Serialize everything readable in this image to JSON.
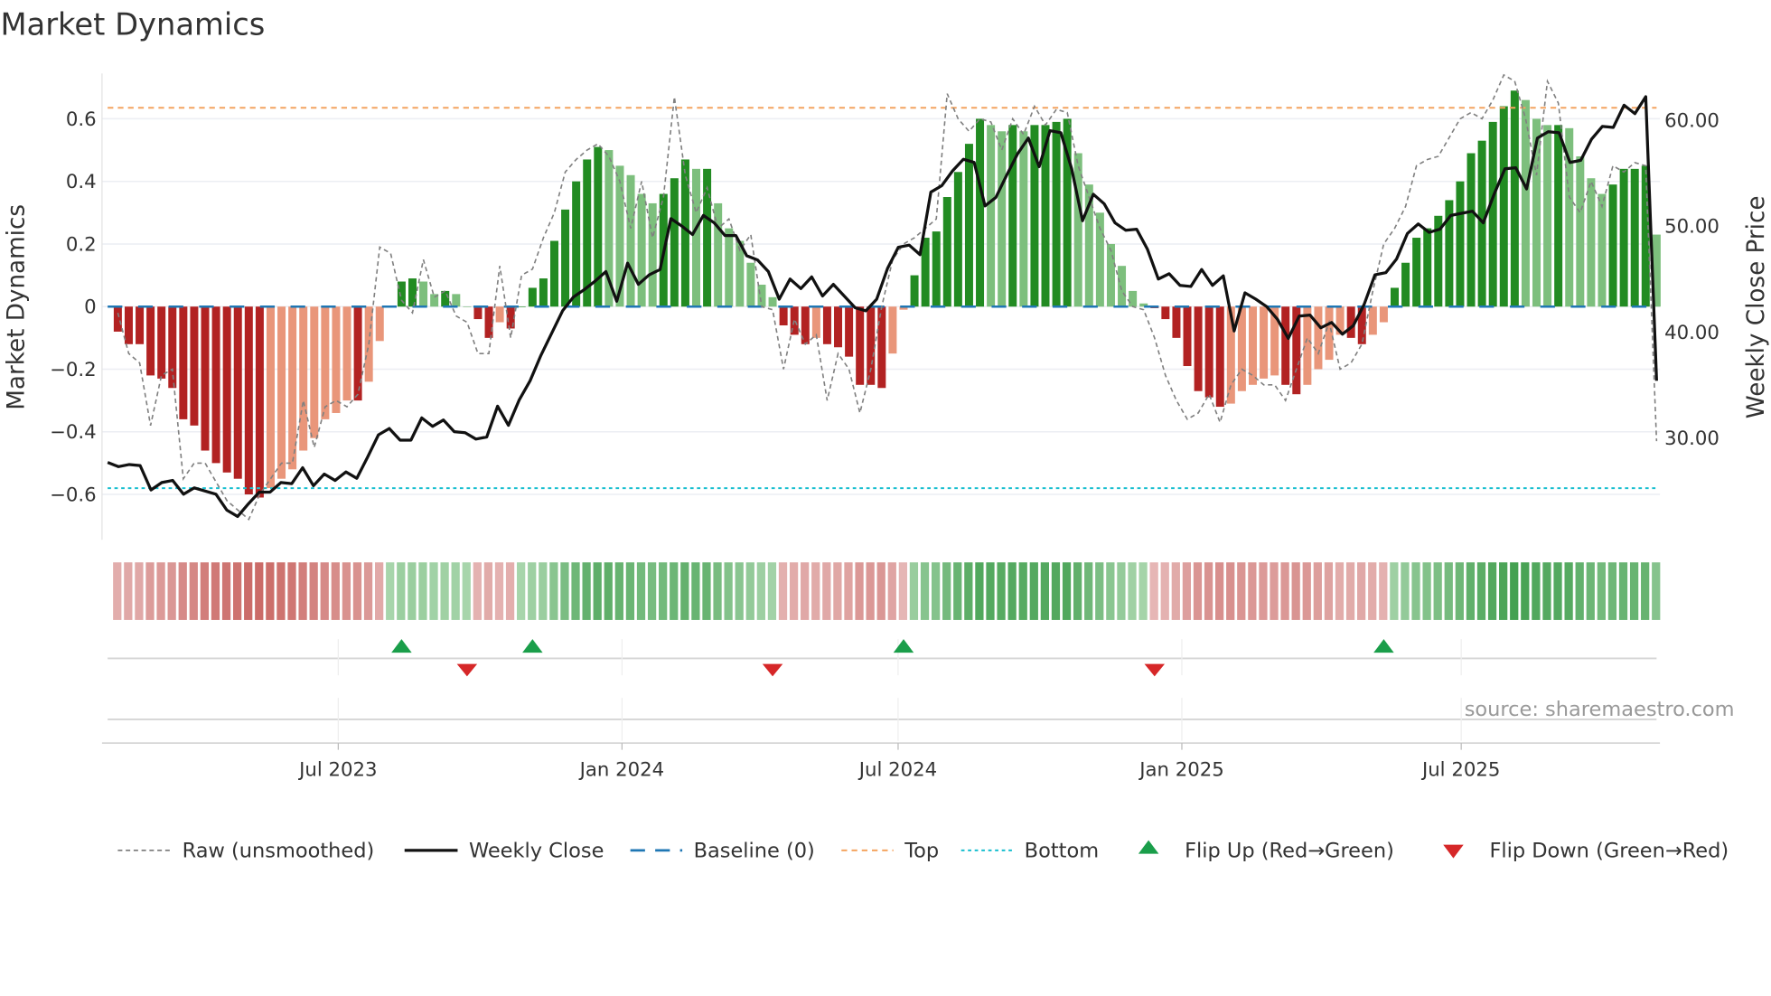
{
  "chart_data": {
    "type": "bar",
    "title": "Market Dynamics",
    "ylabel": "Market Dynamics",
    "y2label": "Weekly Close Price",
    "ylim": [
      -0.745,
      0.745
    ],
    "y2lim": [
      20.4,
      64.4
    ],
    "yticks": [
      {
        "v": 0.6,
        "label": "0.6"
      },
      {
        "v": 0.4,
        "label": "0.4"
      },
      {
        "v": 0.2,
        "label": "0.2"
      },
      {
        "v": 0,
        "label": "0"
      },
      {
        "v": -0.2,
        "label": "−0.2"
      },
      {
        "v": -0.4,
        "label": "−0.4"
      },
      {
        "v": -0.6,
        "label": "−0.6"
      }
    ],
    "y2ticks": [
      {
        "v": 60,
        "label": "60.00"
      },
      {
        "v": 50,
        "label": "50.00"
      },
      {
        "v": 40,
        "label": "40.00"
      },
      {
        "v": 30,
        "label": "30.00"
      }
    ],
    "xticks": [
      {
        "week": 20.2,
        "label": "Jul 2023"
      },
      {
        "week": 46.2,
        "label": "Jan 2024"
      },
      {
        "week": 71.5,
        "label": "Jul 2024"
      },
      {
        "week": 97.5,
        "label": "Jan 2025"
      },
      {
        "week": 123.1,
        "label": "Jul 2025"
      }
    ],
    "top_level": 0.635,
    "bottom_level": -0.58,
    "baseline": 0,
    "smoothed": [
      -0.08,
      -0.12,
      -0.12,
      -0.22,
      -0.23,
      -0.26,
      -0.36,
      -0.38,
      -0.46,
      -0.5,
      -0.53,
      -0.55,
      -0.6,
      -0.61,
      -0.58,
      -0.55,
      -0.52,
      -0.46,
      -0.42,
      -0.36,
      -0.34,
      -0.3,
      -0.3,
      -0.24,
      -0.11,
      0.0,
      0.08,
      0.09,
      0.08,
      0.04,
      0.05,
      0.04,
      0.0,
      -0.04,
      -0.1,
      -0.05,
      -0.07,
      0.0,
      0.06,
      0.09,
      0.21,
      0.31,
      0.4,
      0.47,
      0.51,
      0.5,
      0.45,
      0.42,
      0.36,
      0.33,
      0.36,
      0.41,
      0.47,
      0.44,
      0.44,
      0.33,
      0.25,
      0.21,
      0.14,
      0.07,
      0.03,
      -0.06,
      -0.09,
      -0.12,
      -0.1,
      -0.12,
      -0.13,
      -0.16,
      -0.25,
      -0.25,
      -0.26,
      -0.15,
      -0.01,
      0.1,
      0.22,
      0.24,
      0.35,
      0.43,
      0.52,
      0.6,
      0.58,
      0.56,
      0.58,
      0.56,
      0.58,
      0.58,
      0.59,
      0.6,
      0.49,
      0.39,
      0.3,
      0.2,
      0.13,
      0.05,
      0.01,
      -0.005,
      -0.04,
      -0.1,
      -0.19,
      -0.27,
      -0.29,
      -0.32,
      -0.31,
      -0.27,
      -0.25,
      -0.23,
      -0.22,
      -0.25,
      -0.28,
      -0.25,
      -0.2,
      -0.17,
      -0.09,
      -0.1,
      -0.12,
      -0.09,
      -0.05,
      0.06,
      0.14,
      0.22,
      0.25,
      0.29,
      0.34,
      0.4,
      0.49,
      0.53,
      0.59,
      0.64,
      0.69,
      0.66,
      0.6,
      0.58,
      0.58,
      0.57,
      0.48,
      0.41,
      0.36,
      0.39,
      0.44,
      0.44,
      0.45,
      0.23
    ],
    "raw": [
      -0.02,
      -0.15,
      -0.18,
      -0.38,
      -0.22,
      -0.2,
      -0.55,
      -0.5,
      -0.5,
      -0.56,
      -0.62,
      -0.65,
      -0.68,
      -0.6,
      -0.55,
      -0.5,
      -0.5,
      -0.3,
      -0.45,
      -0.32,
      -0.3,
      -0.32,
      -0.28,
      -0.12,
      0.19,
      0.17,
      0.02,
      -0.02,
      0.15,
      0.03,
      0.05,
      -0.03,
      -0.05,
      -0.15,
      -0.15,
      0.13,
      -0.1,
      0.1,
      0.12,
      0.22,
      0.3,
      0.43,
      0.47,
      0.5,
      0.52,
      0.48,
      0.4,
      0.25,
      0.4,
      0.22,
      0.35,
      0.67,
      0.42,
      0.3,
      0.38,
      0.25,
      0.28,
      0.18,
      0.23,
      0.0,
      -0.01,
      -0.2,
      -0.04,
      -0.12,
      -0.09,
      -0.3,
      -0.15,
      -0.2,
      -0.34,
      -0.2,
      0.0,
      0.15,
      0.2,
      0.22,
      0.25,
      0.28,
      0.68,
      0.6,
      0.56,
      0.6,
      0.59,
      0.5,
      0.6,
      0.55,
      0.64,
      0.58,
      0.63,
      0.62,
      0.45,
      0.35,
      0.25,
      0.18,
      0.05,
      0.0,
      -0.01,
      -0.1,
      -0.22,
      -0.3,
      -0.36,
      -0.34,
      -0.28,
      -0.37,
      -0.25,
      -0.2,
      -0.22,
      -0.25,
      -0.25,
      -0.3,
      -0.2,
      -0.1,
      -0.15,
      -0.05,
      -0.2,
      -0.18,
      -0.12,
      0.05,
      0.2,
      0.25,
      0.32,
      0.45,
      0.47,
      0.48,
      0.54,
      0.6,
      0.62,
      0.6,
      0.66,
      0.74,
      0.72,
      0.6,
      0.42,
      0.72,
      0.65,
      0.35,
      0.3,
      0.4,
      0.32,
      0.45,
      0.43,
      0.46,
      0.45,
      -0.43
    ],
    "weekly_close": [
      27.7,
      27.3,
      27.5,
      27.4,
      25.1,
      25.8,
      26.0,
      24.7,
      25.3,
      25.0,
      24.7,
      23.2,
      22.6,
      23.8,
      24.9,
      24.9,
      25.8,
      25.7,
      27.2,
      25.5,
      26.6,
      26.0,
      26.8,
      26.2,
      28.2,
      30.3,
      30.9,
      29.8,
      29.8,
      31.9,
      31.1,
      31.7,
      30.6,
      30.5,
      29.9,
      30.1,
      33.0,
      31.2,
      33.6,
      35.4,
      37.8,
      39.9,
      42.0,
      43.3,
      44.0,
      44.8,
      45.7,
      42.9,
      46.5,
      44.5,
      45.4,
      45.9,
      50.7,
      50.0,
      49.2,
      51.0,
      50.3,
      49.1,
      49.1,
      47.2,
      46.8,
      45.7,
      43.1,
      45.0,
      44.1,
      45.2,
      43.4,
      44.5,
      43.4,
      42.3,
      42.0,
      43.1,
      46.0,
      48.0,
      48.2,
      47.3,
      53.2,
      53.8,
      55.2,
      56.3,
      56.0,
      51.9,
      52.7,
      54.8,
      56.8,
      58.3,
      55.6,
      59.0,
      58.8,
      55.4,
      50.5,
      53.0,
      52.1,
      50.3,
      49.6,
      49.7,
      47.8,
      45.0,
      45.5,
      44.4,
      44.3,
      45.9,
      44.4,
      45.3,
      40.1,
      43.7,
      43.1,
      42.4,
      41.2,
      39.4,
      41.5,
      41.6,
      40.4,
      40.9,
      39.8,
      40.6,
      42.6,
      45.4,
      45.6,
      46.9,
      49.3,
      50.2,
      49.4,
      49.7,
      51.0,
      51.2,
      51.4,
      50.3,
      53.0,
      55.4,
      55.5,
      53.5,
      58.3,
      58.9,
      58.8,
      56.0,
      56.2,
      58.2,
      59.4,
      59.3,
      61.4,
      60.6,
      62.2,
      35.4
    ],
    "flip_up_weeks": [
      26,
      38,
      72,
      116
    ],
    "flip_down_weeks": [
      32,
      60,
      95
    ],
    "colors": {
      "up_strong": "#228b22",
      "up_weak": "#7dbf7d",
      "down_strong": "#b22222",
      "down_weak": "#e9967a",
      "close": "#111111",
      "raw": "#808080",
      "baseline": "#1f77b4",
      "top": "#f4a460",
      "bottom": "#17becf",
      "flip_up": "#1a9e4a",
      "flip_down": "#d62728"
    },
    "legend": {
      "position": "bottom",
      "raw": "Raw (unsmoothed)",
      "close": "Weekly Close",
      "baseline": "Baseline (0)",
      "top": "Top",
      "bottom": "Bottom",
      "flip_up": "Flip Up (Red→Green)",
      "flip_down": "Flip Down (Green→Red)"
    },
    "source": "source: sharemaestro.com"
  }
}
